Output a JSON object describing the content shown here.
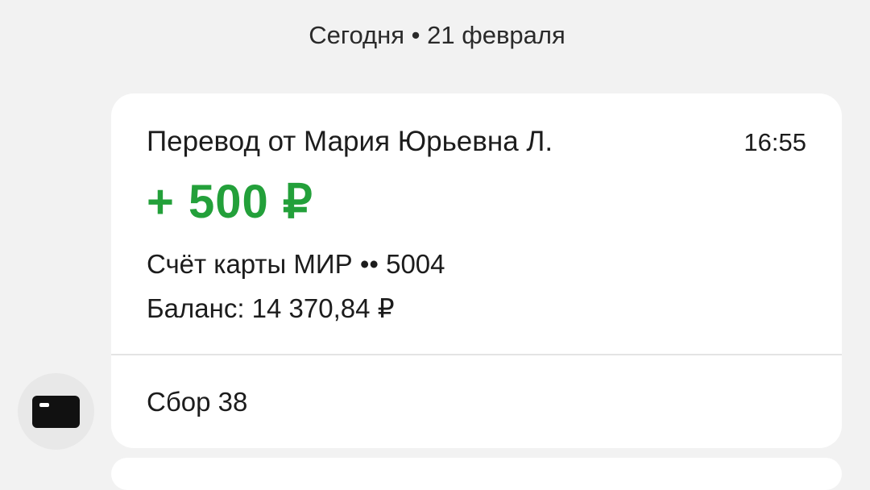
{
  "feed": {
    "date_header": "Сегодня • 21 февраля"
  },
  "transaction": {
    "title": "Перевод от Мария Юрьевна Л.",
    "time": "16:55",
    "amount": "+ 500 ₽",
    "amount_color": "#23a03a",
    "account": "Счёт карты МИР •• 5004",
    "balance": "Баланс: 14 370,84 ₽",
    "category": "Сбор 38",
    "category_icon": "card-icon"
  }
}
